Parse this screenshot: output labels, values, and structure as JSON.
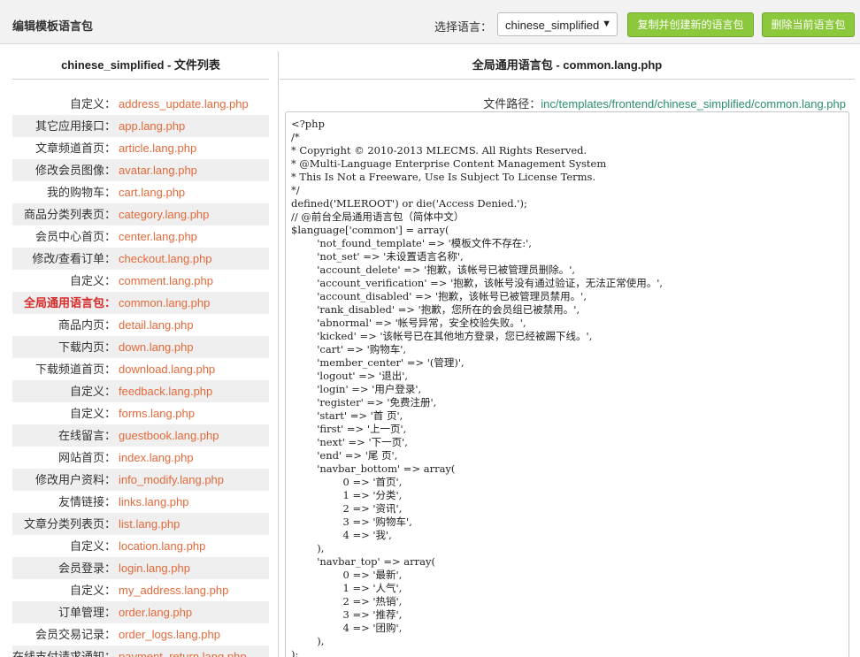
{
  "header": {
    "title": "编辑模板语言包",
    "lang_label": "选择语言：",
    "lang_selected": "chinese_simplified",
    "copy_button": "复制并创建新的语言包",
    "delete_button": "删除当前语言包",
    "dropdown_icon": "chevron-down-icon",
    "accent_color": "#8cc83c"
  },
  "sidebar": {
    "heading": "chinese_simplified - 文件列表",
    "items": [
      {
        "label": "自定义：",
        "file": "address_update.lang.php"
      },
      {
        "label": "其它应用接口：",
        "file": "app.lang.php"
      },
      {
        "label": "文章频道首页：",
        "file": "article.lang.php"
      },
      {
        "label": "修改会员图像：",
        "file": "avatar.lang.php"
      },
      {
        "label": "我的购物车：",
        "file": "cart.lang.php"
      },
      {
        "label": "商品分类列表页：",
        "file": "category.lang.php"
      },
      {
        "label": "会员中心首页：",
        "file": "center.lang.php"
      },
      {
        "label": "修改/查看订单：",
        "file": "checkout.lang.php"
      },
      {
        "label": "自定义：",
        "file": "comment.lang.php"
      },
      {
        "label": "全局通用语言包：",
        "file": "common.lang.php",
        "active": true
      },
      {
        "label": "商品内页：",
        "file": "detail.lang.php"
      },
      {
        "label": "下载内页：",
        "file": "down.lang.php"
      },
      {
        "label": "下载频道首页：",
        "file": "download.lang.php"
      },
      {
        "label": "自定义：",
        "file": "feedback.lang.php"
      },
      {
        "label": "自定义：",
        "file": "forms.lang.php"
      },
      {
        "label": "在线留言：",
        "file": "guestbook.lang.php"
      },
      {
        "label": "网站首页：",
        "file": "index.lang.php"
      },
      {
        "label": "修改用户资料：",
        "file": "info_modify.lang.php"
      },
      {
        "label": "友情链接：",
        "file": "links.lang.php"
      },
      {
        "label": "文章分类列表页：",
        "file": "list.lang.php"
      },
      {
        "label": "自定义：",
        "file": "location.lang.php"
      },
      {
        "label": "会员登录：",
        "file": "login.lang.php"
      },
      {
        "label": "自定义：",
        "file": "my_address.lang.php"
      },
      {
        "label": "订单管理：",
        "file": "order.lang.php"
      },
      {
        "label": "会员交易记录：",
        "file": "order_logs.lang.php"
      },
      {
        "label": "在线支付请求通知：",
        "file": "payment_return.lang.php"
      }
    ]
  },
  "main": {
    "heading": "全局通用语言包 - common.lang.php",
    "path_label": "文件路径：",
    "path_value": "inc/templates/frontend/chinese_simplified/common.lang.php",
    "code": "<?php\n/*\n* Copyright © 2010-2013 MLECMS. All Rights Reserved.\n* @Multi-Language Enterprise Content Management System\n* This Is Not a Freeware, Use Is Subject To License Terms.\n*/\ndefined('MLEROOT') or die('Access Denied.');\n// @前台全局通用语言包（简体中文）\n$language['common'] = array(\n        'not_found_template' => '模板文件不存在:',\n        'not_set' => '未设置语言名称',\n        'account_delete' => '抱歉，该帐号已被管理员删除。',\n        'account_verification' => '抱歉，该帐号没有通过验证，无法正常使用。',\n        'account_disabled' => '抱歉，该帐号已被管理员禁用。',\n        'rank_disabled' => '抱歉，您所在的会员组已被禁用。',\n        'abnormal' => '帐号异常，安全校验失败。',\n        'kicked' => '该帐号已在其他地方登录，您已经被踢下线。',\n        'cart' => '购物车',\n        'member_center' => '(管理)',\n        'logout' => '退出',\n        'login' => '用户登录',\n        'register' => '免费注册',\n        'start' => '首 页',\n        'first' => '上一页',\n        'next' => '下一页',\n        'end' => '尾 页',\n        'navbar_bottom' => array(\n                0 => '首页',\n                1 => '分类',\n                2 => '资讯',\n                3 => '购物车',\n                4 => '我',\n        ),\n        'navbar_top' => array(\n                0 => '最新',\n                1 => '人气',\n                2 => '热销',\n                3 => '推荐',\n                4 => '团购',\n        ),\n);"
  }
}
